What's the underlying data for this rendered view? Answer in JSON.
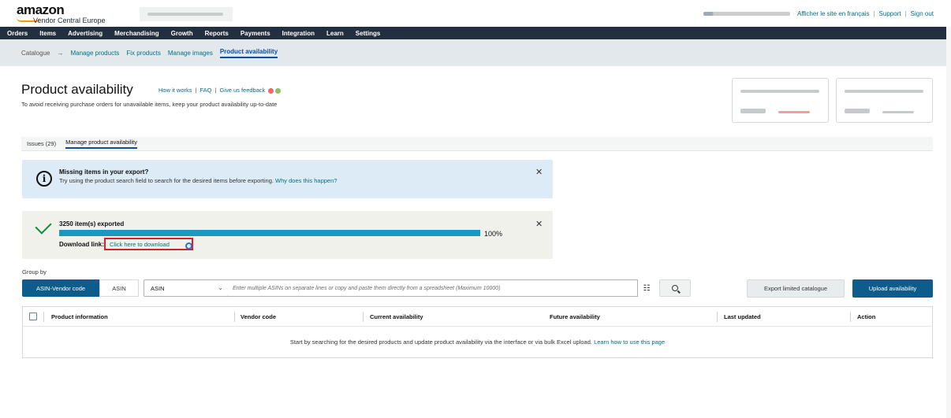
{
  "header": {
    "logo_text": "amazon",
    "logo_subtitle": "Vendor Central Europe",
    "links": {
      "french": "Afficher le site en français",
      "support": "Support",
      "signout": "Sign out"
    }
  },
  "nav": {
    "items": [
      "Orders",
      "Items",
      "Advertising",
      "Merchandising",
      "Growth",
      "Reports",
      "Payments",
      "Integration",
      "Learn",
      "Settings"
    ]
  },
  "subnav": {
    "catalogue": "Catalogue",
    "arrow": "→",
    "items": [
      "Manage products",
      "Fix products",
      "Manage images",
      "Product availability"
    ]
  },
  "page": {
    "title": "Product availability",
    "links": [
      "How it works",
      "FAQ",
      "Give us feedback"
    ],
    "link_separator": "|",
    "description": "To avoid receiving purchase orders for unavailable items, keep your product availability up-to-date"
  },
  "tabs": [
    "Issues (29)",
    "Manage product availability"
  ],
  "info_alert": {
    "title": "Missing items in your export?",
    "text": "Try using the product search field to search for the desired items before exporting.",
    "link": "Why does this happen?"
  },
  "export_alert": {
    "title": "3250 item(s) exported",
    "progress_percent": 100,
    "percent_label": "100%",
    "download_label": "Download link:",
    "download_link": "Click here to download"
  },
  "controls": {
    "group_by_label": "Group by",
    "group_options": [
      "ASIN-Vendor code",
      "ASIN"
    ],
    "select_value": "ASIN",
    "search_placeholder": "Enter multiple ASINs on separate lines or copy and paste them directly from a spreadsheet (Maximum 10000)",
    "export_button": "Export limited catalogue",
    "upload_button": "Upload availability"
  },
  "table": {
    "columns": [
      "Product information",
      "Vendor code",
      "Current availability",
      "Future availability",
      "Last updated",
      "Action"
    ],
    "empty_text": "Start by searching for the desired products and update product availability via the interface or via bulk Excel upload.",
    "empty_link": "Learn how to use this page"
  },
  "colors": {
    "nav_bg": "#232f3e",
    "primary_button": "#0d5d8c",
    "progress": "#1a98c0",
    "link": "#007185",
    "highlight_box": "#d81f26"
  }
}
